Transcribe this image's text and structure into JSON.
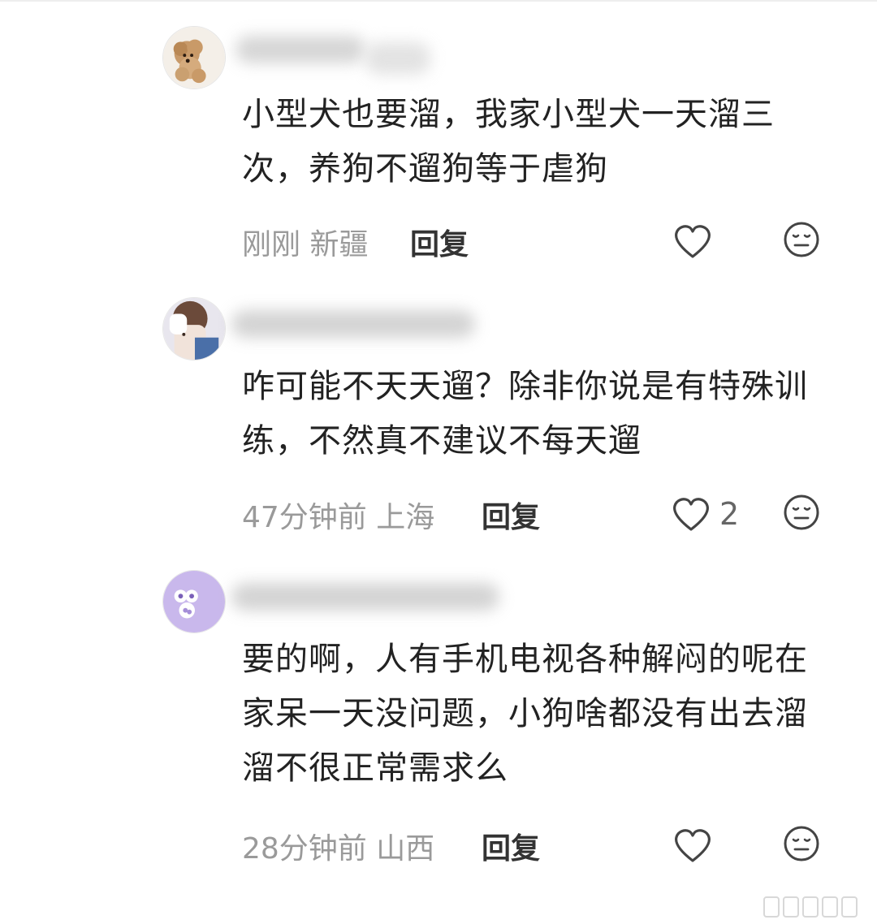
{
  "comments": [
    {
      "avatar_icon": "poodle-avatar",
      "text": "小型犬也要溜，我家小型犬一天溜三次，养狗不遛狗等于虐狗",
      "time_location": "刚刚 新疆",
      "reply_label": "回复",
      "like_count": "",
      "like_icon": "heart-outline-icon",
      "dislike_icon": "meh-face-icon"
    },
    {
      "avatar_icon": "anime-avatar",
      "text": "咋可能不天天遛？除非你说是有特殊训练，不然真不建议不每天遛",
      "time_location": "47分钟前 上海",
      "reply_label": "回复",
      "like_count": "2",
      "like_icon": "heart-outline-icon",
      "dislike_icon": "meh-face-icon"
    },
    {
      "avatar_icon": "purple-cartoon-avatar",
      "text": "要的啊，人有手机电视各种解闷的呢在家呆一天没问题，小狗啥都没有出去溜溜不很正常需求么",
      "time_location": "28分钟前 山西",
      "reply_label": "回复",
      "like_count": "",
      "like_icon": "heart-outline-icon",
      "dislike_icon": "meh-face-icon"
    }
  ],
  "colors": {
    "text": "#222222",
    "meta": "#9a9a9a",
    "icon": "#444444"
  }
}
